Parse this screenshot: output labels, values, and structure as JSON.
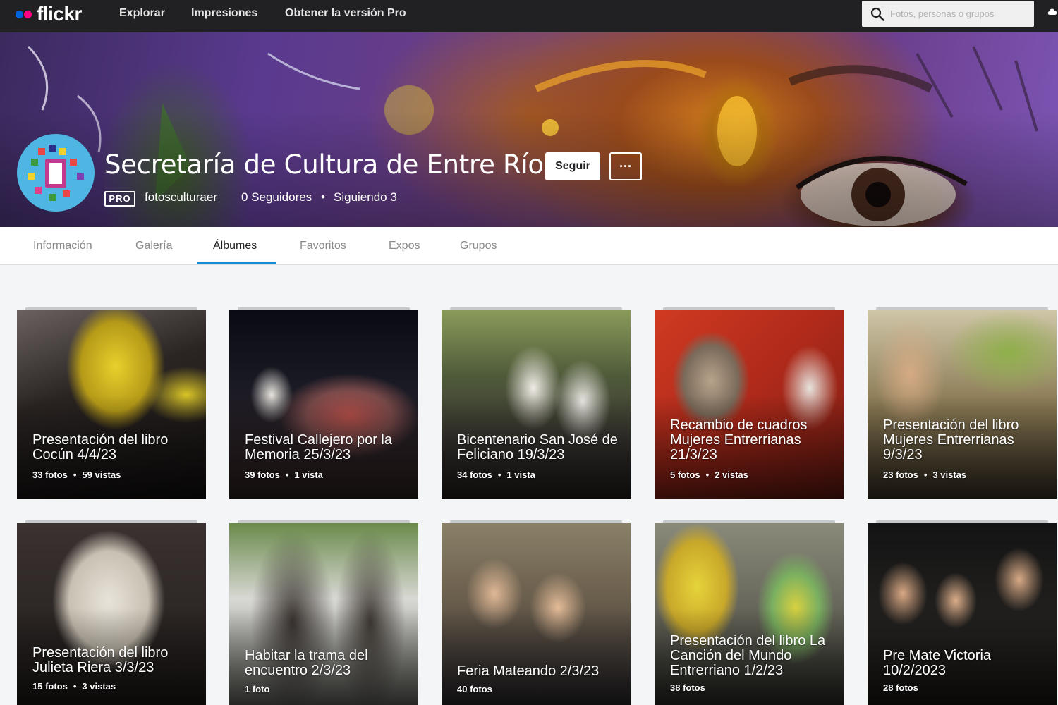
{
  "nav": {
    "logo": "flickr",
    "links": [
      "Explorar",
      "Impresiones",
      "Obtener la versión Pro"
    ],
    "search_placeholder": "Fotos, personas o grupos"
  },
  "profile": {
    "name": "Secretaría de Cultura de Entre Ríos",
    "follow_label": "Seguir",
    "more_label": "···",
    "pro_badge": "PRO",
    "screen_name": "fotosculturaer",
    "followers": "0 Seguidores",
    "separator": "•",
    "following": "Siguiendo 3"
  },
  "subnav": {
    "tabs": [
      "Información",
      "Galería",
      "Álbumes",
      "Favoritos",
      "Expos",
      "Grupos"
    ],
    "active_tab": "Álbumes"
  },
  "albums": [
    {
      "title": "Presentación del libro Cocún 4/4/23",
      "photos": "33 fotos",
      "views": "59 vistas"
    },
    {
      "title": "Festival Callejero por la Memoria 25/3/23",
      "photos": "39 fotos",
      "views": "1 vista"
    },
    {
      "title": "Bicentenario San José de Feliciano 19/3/23",
      "photos": "34 fotos",
      "views": "1 vista"
    },
    {
      "title": "Recambio de cuadros Mujeres Entrerrianas 21/3/23",
      "photos": "5 fotos",
      "views": "2 vistas"
    },
    {
      "title": "Presentación del libro Mujeres Entrerrianas 9/3/23",
      "photos": "23 fotos",
      "views": "3 vistas"
    },
    {
      "title": "Presentación del libro Julieta Riera 3/3/23",
      "photos": "15 fotos",
      "views": "3 vistas"
    },
    {
      "title": "Habitar la trama del encuentro 2/3/23",
      "photos": "1 foto",
      "views": ""
    },
    {
      "title": "Feria Mateando 2/3/23",
      "photos": "40 fotos",
      "views": ""
    },
    {
      "title": "Presentación del libro La Canción del Mundo Entrerriano 1/2/23",
      "photos": "38 fotos",
      "views": ""
    },
    {
      "title": "Pre Mate Victoria 10/2/2023",
      "photos": "28 fotos",
      "views": ""
    }
  ],
  "colors": {
    "topbar": "#212124",
    "accent": "#128fdc",
    "flickr_blue": "#0063dc",
    "flickr_pink": "#ff0084"
  },
  "icons": [
    "search-icon",
    "upload-cloud-icon",
    "more-icon"
  ]
}
